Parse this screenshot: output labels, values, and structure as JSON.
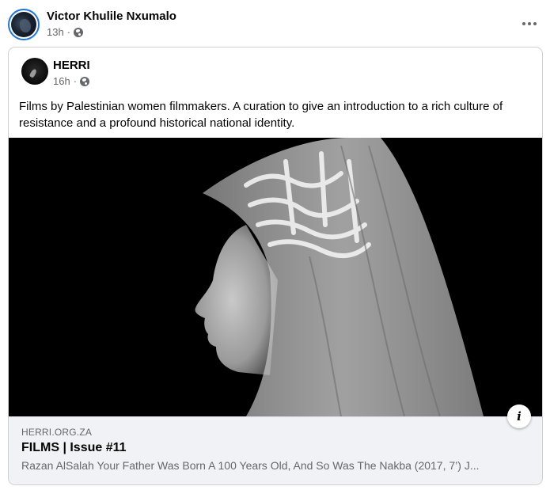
{
  "post": {
    "author_name": "Victor Khulile Nxumalo",
    "time": "13h",
    "separator": "·",
    "privacy_icon": "globe-icon",
    "more_icon": "more-options-icon"
  },
  "shared_post": {
    "author_name": "HERRI",
    "time": "16h",
    "separator": "·",
    "privacy_icon": "globe-icon",
    "text": "Films by Palestinian women filmmakers. A curation to give an introduction to a rich culture of resistance and a profound historical national identity.",
    "image_icon": "portrait-photo",
    "info_label": "i"
  },
  "link_preview": {
    "domain": "HERRI.ORG.ZA",
    "title": "FILMS | Issue #11",
    "description": "Razan AlSalah Your Father Was Born A 100 Years Old, And So Was The Nakba (2017, 7’) J..."
  },
  "colors": {
    "accent": "#1b74e4",
    "secondary_text": "#65676b",
    "preview_bg": "#f0f2f5"
  }
}
